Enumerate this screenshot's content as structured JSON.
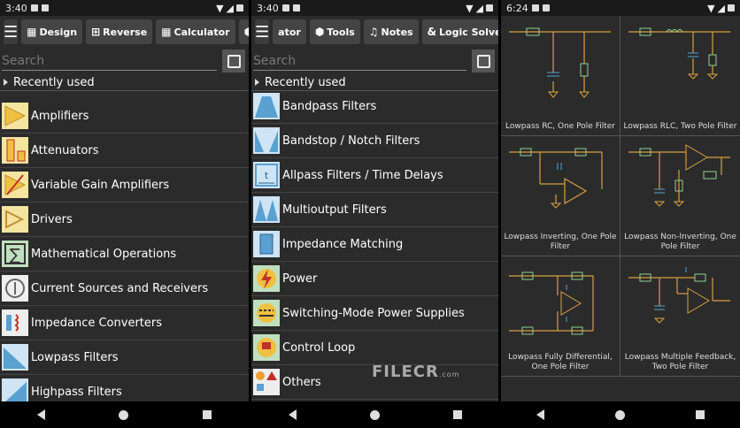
{
  "screen1": {
    "status_time": "3:40",
    "toolbar": [
      "Design",
      "Reverse",
      "Calculator"
    ],
    "search_placeholder": "Search",
    "recent_label": "Recently used",
    "items": [
      {
        "label": "Amplifiers",
        "icon": "amplifier-icon"
      },
      {
        "label": "Attenuators",
        "icon": "attenuator-icon"
      },
      {
        "label": "Variable Gain Amplifiers",
        "icon": "vga-icon"
      },
      {
        "label": "Drivers",
        "icon": "driver-icon"
      },
      {
        "label": "Mathematical Operations",
        "icon": "math-icon"
      },
      {
        "label": "Current Sources and Receivers",
        "icon": "current-source-icon"
      },
      {
        "label": "Impedance Converters",
        "icon": "impedance-converter-icon"
      },
      {
        "label": "Lowpass Filters",
        "icon": "lowpass-icon"
      },
      {
        "label": "Highpass Filters",
        "icon": "highpass-icon"
      }
    ]
  },
  "screen2": {
    "status_time": "3:40",
    "toolbar": [
      "ator",
      "Tools",
      "Notes",
      "Logic Solver"
    ],
    "search_placeholder": "Search",
    "recent_label": "Recently used",
    "items": [
      {
        "label": "Bandpass Filters",
        "icon": "bandpass-icon"
      },
      {
        "label": "Bandstop / Notch Filters",
        "icon": "bandstop-icon"
      },
      {
        "label": "Allpass Filters / Time Delays",
        "icon": "allpass-icon"
      },
      {
        "label": "Multioutput Filters",
        "icon": "multioutput-icon"
      },
      {
        "label": "Impedance Matching",
        "icon": "impedance-matching-icon"
      },
      {
        "label": "Power",
        "icon": "power-icon"
      },
      {
        "label": "Switching-Mode Power Supplies",
        "icon": "smps-icon"
      },
      {
        "label": "Control Loop",
        "icon": "control-loop-icon"
      },
      {
        "label": "Others",
        "icon": "others-icon"
      }
    ]
  },
  "screen3": {
    "status_time": "6:24",
    "circuits": [
      {
        "caption": "Lowpass RC, One Pole Filter"
      },
      {
        "caption": "Lowpass RLC, Two Pole Filter"
      },
      {
        "caption": "Lowpass Inverting, One Pole Filter"
      },
      {
        "caption": "Lowpass Non-Inverting, One Pole Filter"
      },
      {
        "caption": "Lowpass Fully Differential, One Pole Filter"
      },
      {
        "caption": "Lowpass Multiple Feedback, Two Pole Filter"
      }
    ]
  },
  "watermark": {
    "text": "FILECR",
    "suffix": ".com"
  },
  "colors": {
    "background": "#2b2b2b",
    "accent": "#f0c040",
    "wire": "#d8a040",
    "component": "#8fd08f"
  }
}
